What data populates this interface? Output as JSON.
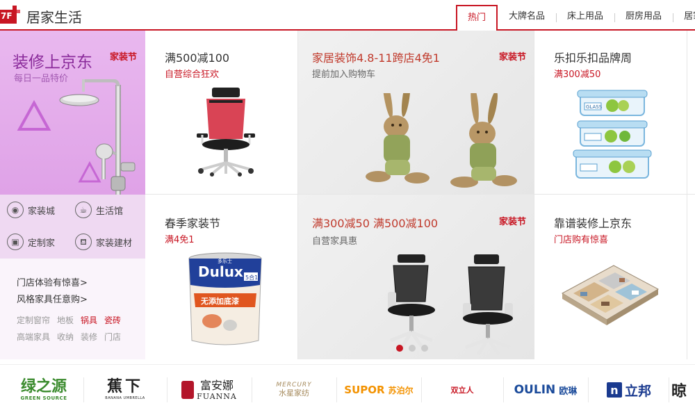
{
  "floor": {
    "number": "7F",
    "title": "居家生活",
    "accent_color": "#c81623"
  },
  "tabs": [
    {
      "label": "热门",
      "active": true
    },
    {
      "label": "大牌名品",
      "active": false
    },
    {
      "label": "床上用品",
      "active": false
    },
    {
      "label": "厨房用品",
      "active": false
    },
    {
      "label": "居家",
      "active": false
    }
  ],
  "left_panel": {
    "promo_title": "装修上京东",
    "promo_subtitle": "每日一品特价",
    "promo_tag": "家装节",
    "quick_links": [
      {
        "label": "家装城",
        "icon": "shield-house-icon"
      },
      {
        "label": "生活馆",
        "icon": "cup-icon"
      },
      {
        "label": "定制家",
        "icon": "cabinet-icon"
      },
      {
        "label": "家装建材",
        "icon": "sofa-icon"
      }
    ],
    "text_links": [
      "门店体验有惊喜>",
      "风格家具任意购>"
    ],
    "keywords_row1": [
      {
        "label": "定制窗帘",
        "hot": false
      },
      {
        "label": "地板",
        "hot": false
      },
      {
        "label": "锅具",
        "hot": true
      },
      {
        "label": "瓷砖",
        "hot": true
      }
    ],
    "keywords_row2": [
      {
        "label": "高端家具",
        "hot": false
      },
      {
        "label": "收纳",
        "hot": false
      },
      {
        "label": "装修",
        "hot": false
      },
      {
        "label": "门店",
        "hot": false
      }
    ]
  },
  "cells": {
    "chair": {
      "title": "满500减100",
      "subtitle": "自营综合狂欢"
    },
    "rabbit": {
      "title": "家居装饰4.8-11跨店4免1",
      "subtitle": "提前加入购物车",
      "tag": "家装节"
    },
    "lock": {
      "title": "乐扣乐扣品牌周",
      "subtitle": "满300减50"
    },
    "paint": {
      "title": "春季家装节",
      "subtitle": "满4免1",
      "product_brand": "Dulux",
      "product_text": "多乐士",
      "product_badge": "5合1",
      "product_name": "无添加底漆"
    },
    "office": {
      "title": "满300减50 满500减100",
      "subtitle": "自营家具惠",
      "tag": "家装节"
    },
    "house": {
      "title": "靠谱装修上京东",
      "subtitle": "门店购有惊喜"
    },
    "lock_label": "GLASS"
  },
  "brands": [
    {
      "name": "绿之源",
      "sub": "GREEN SOURCE"
    },
    {
      "name": "蕉下",
      "sub": "BANANA UMBRELLA"
    },
    {
      "name": "富安娜",
      "sub": "FUANNA"
    },
    {
      "name": "水星家纺",
      "sub": "MERCURY"
    },
    {
      "name": "SUPOR",
      "sub": "苏泊尔"
    },
    {
      "name": "双立人",
      "sub": ""
    },
    {
      "name": "OULIN",
      "sub": "欧琳"
    },
    {
      "name": "立邦",
      "sub": "n"
    },
    {
      "name": "晾",
      "sub": ""
    }
  ]
}
